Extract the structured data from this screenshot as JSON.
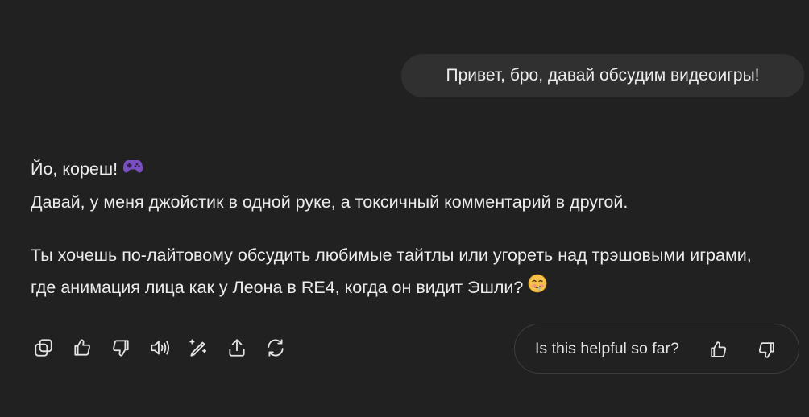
{
  "user_message": {
    "text": "Привет, бро, давай обсудим видеоигры!"
  },
  "assistant_message": {
    "line1": "Йо, кореш!",
    "line1_icon": "game-controller-icon",
    "line2": "Давай, у меня джойстик в одной руке, а токсичный комментарий в другой.",
    "paragraph2": "Ты хочешь по-лайтовому обсудить любимые тайтлы или угореть над трэшовыми играми, где анимация лица как у Леона в RE4, когда он видит Эшли?",
    "paragraph2_icon": "drooling-face-icon"
  },
  "actions": [
    {
      "name": "copy",
      "icon": "copy-icon"
    },
    {
      "name": "thumbs-up",
      "icon": "thumbs-up-icon"
    },
    {
      "name": "thumbs-down",
      "icon": "thumbs-down-icon"
    },
    {
      "name": "read-aloud",
      "icon": "speaker-icon"
    },
    {
      "name": "edit",
      "icon": "pencil-sparkle-icon"
    },
    {
      "name": "share",
      "icon": "share-icon"
    },
    {
      "name": "regenerate",
      "icon": "refresh-icon"
    }
  ],
  "feedback": {
    "label": "Is this helpful so far?",
    "up_icon": "thumbs-up-icon",
    "down_icon": "thumbs-down-icon"
  },
  "colors": {
    "background": "#212121",
    "user_bubble": "#303030",
    "text": "#ececec",
    "controller_purple": "#7b4fc4"
  }
}
